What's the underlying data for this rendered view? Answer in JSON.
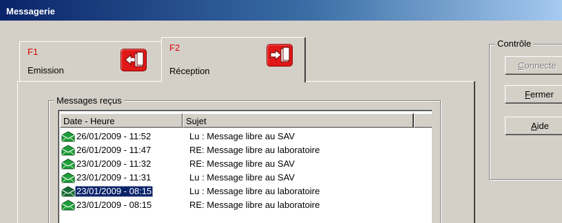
{
  "window": {
    "title": "Messagerie"
  },
  "tabs": [
    {
      "key": "F1",
      "label": "Emission"
    },
    {
      "key": "F2",
      "label": "Réception"
    }
  ],
  "messages": {
    "legend": "Messages reçus",
    "columns": {
      "date": "Date - Heure",
      "subject": "Sujet"
    },
    "rows": [
      {
        "date": "26/01/2009 - 11:52",
        "subject": "Lu : Message libre au SAV",
        "icon": "envelope-read-icon",
        "selected": false
      },
      {
        "date": "26/01/2009 - 11:47",
        "subject": "RE: Message libre au laboratoire",
        "icon": "envelope-read-icon",
        "selected": false
      },
      {
        "date": "23/01/2009 - 11:32",
        "subject": "RE: Message libre au SAV",
        "icon": "envelope-read-icon",
        "selected": false
      },
      {
        "date": "23/01/2009 - 11:31",
        "subject": "Lu : Message libre au SAV",
        "icon": "envelope-read-icon",
        "selected": false
      },
      {
        "date": "23/01/2009 - 08:15",
        "subject": "Lu : Message libre au laboratoire",
        "icon": "envelope-read-icon",
        "selected": true
      },
      {
        "date": "23/01/2009 - 08:15",
        "subject": "RE: Message libre au laboratoire",
        "icon": "envelope-read-icon",
        "selected": false
      }
    ]
  },
  "controle": {
    "legend": "Contrôle",
    "connect_label": "Connecte",
    "close_label": "Fermer",
    "help_label": "Aide"
  },
  "colors": {
    "title_bar": "#0a246a",
    "selection": "#0a246a",
    "tab_key": "#d40000",
    "tab_icon": "#e01818",
    "envelope": "#1e9e3a"
  }
}
